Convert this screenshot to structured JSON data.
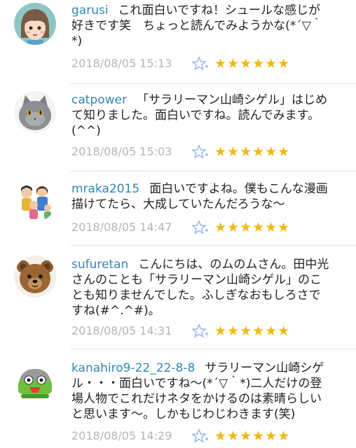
{
  "comments": [
    {
      "username": "garusi",
      "text": "これ面白いですね！シュールな感じが好きです笑　ちょっと読んでみようかな(*´▽｀*)",
      "timestamp": "2018/08/05 15:13",
      "rating": 6,
      "stars": "★★★★★★",
      "avatar_icon": "cartoon-face-avatar"
    },
    {
      "username": "catpower",
      "text": "「サラリーマン山崎シゲル」はじめて知りました。面白いですね。読んでみます。(^^)",
      "timestamp": "2018/08/05 15:03",
      "rating": 6,
      "stars": "★★★★★★",
      "avatar_icon": "gray-cat-avatar"
    },
    {
      "username": "mraka2015",
      "text": "面白いですよね。僕もこんな漫画描けてたら、大成していたんだろうな～",
      "timestamp": "2018/08/05 14:47",
      "rating": 6,
      "stars": "★★★★★★",
      "avatar_icon": "family-illustration-avatar"
    },
    {
      "username": "sufuretan",
      "text": "こんにちは、のムのムさん。田中光さんのことも「サラリーマン山崎シゲル」のことも知りませんでした。ふしぎなおもしろさですね(#^.^#)。",
      "timestamp": "2018/08/05 14:31",
      "rating": 6,
      "stars": "★★★★★★",
      "avatar_icon": "teddy-bear-avatar"
    },
    {
      "username": "kanahiro9-22_22-8-8",
      "text": "サラリーマン山崎シゲル・・・面白いですね～(*´▽｀*)二人だけの登場人物でこれだけネタをかけるのは素晴らしいと思います～。しかもじわじわきます(笑)",
      "timestamp": "2018/08/05 14:29",
      "rating": 6,
      "stars": "★★★★★★",
      "avatar_icon": "green-character-avatar"
    }
  ],
  "colors": {
    "username": "#2e87b8",
    "timestamp": "#b5b5b5",
    "star": "#f2b90e",
    "divider": "#e6e6e6"
  },
  "icons": {
    "favorite": "star-plus-icon"
  }
}
